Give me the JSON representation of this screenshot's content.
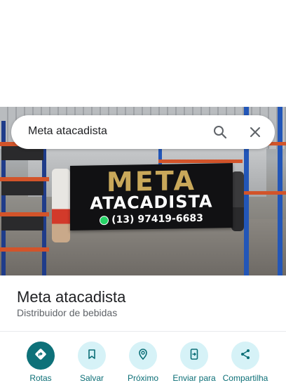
{
  "search": {
    "query": "Meta atacadista"
  },
  "photo": {
    "banner_line1": "META",
    "banner_line2": "ATACADISTA",
    "banner_phone": "(13) 97419-6683"
  },
  "place": {
    "name": "Meta atacadista",
    "category": "Distribuidor de bebidas"
  },
  "actions": [
    {
      "label": "Rotas",
      "icon": "directions-icon"
    },
    {
      "label": "Salvar",
      "icon": "bookmark-icon"
    },
    {
      "label": "Próximo",
      "icon": "nearby-icon"
    },
    {
      "label": "Enviar para",
      "icon": "send-to-phone-icon"
    },
    {
      "label": "Compartilha",
      "icon": "share-icon"
    }
  ],
  "colors": {
    "accent": "#0e7179",
    "action_bg": "#d6f2f7",
    "action_label": "#0b6e76"
  }
}
